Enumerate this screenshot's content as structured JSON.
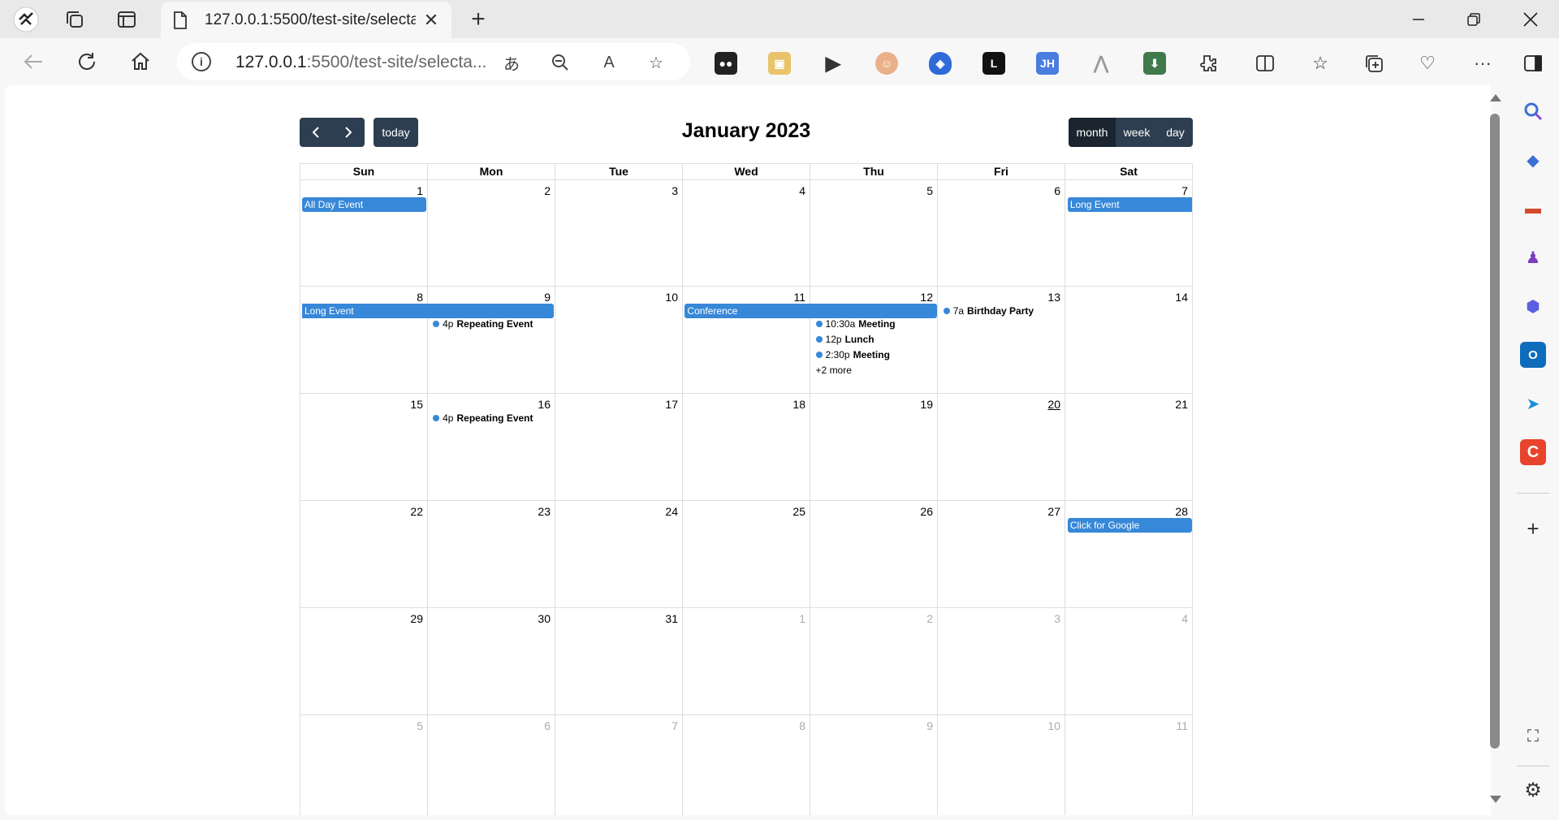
{
  "browser": {
    "tab_title": "127.0.0.1:5500/test-site/selectabl",
    "url_host": "127.0.0.1",
    "url_rest": ":5500/test-site/selecta...",
    "window_controls": [
      "minimize-icon",
      "restore-icon",
      "close-icon"
    ]
  },
  "calendar": {
    "title": "January 2023",
    "today_label": "today",
    "views": [
      "month",
      "week",
      "day"
    ],
    "active_view": "month",
    "day_headers": [
      "Sun",
      "Mon",
      "Tue",
      "Wed",
      "Thu",
      "Fri",
      "Sat"
    ],
    "weeks": [
      [
        {
          "n": "1"
        },
        {
          "n": "2"
        },
        {
          "n": "3"
        },
        {
          "n": "4"
        },
        {
          "n": "5"
        },
        {
          "n": "6"
        },
        {
          "n": "7"
        }
      ],
      [
        {
          "n": "8"
        },
        {
          "n": "9"
        },
        {
          "n": "10"
        },
        {
          "n": "11"
        },
        {
          "n": "12"
        },
        {
          "n": "13"
        },
        {
          "n": "14"
        }
      ],
      [
        {
          "n": "15"
        },
        {
          "n": "16"
        },
        {
          "n": "17"
        },
        {
          "n": "18"
        },
        {
          "n": "19"
        },
        {
          "n": "20",
          "today": true
        },
        {
          "n": "21"
        }
      ],
      [
        {
          "n": "22"
        },
        {
          "n": "23"
        },
        {
          "n": "24"
        },
        {
          "n": "25"
        },
        {
          "n": "26"
        },
        {
          "n": "27"
        },
        {
          "n": "28"
        }
      ],
      [
        {
          "n": "29"
        },
        {
          "n": "30"
        },
        {
          "n": "31"
        },
        {
          "n": "1",
          "other": true
        },
        {
          "n": "2",
          "other": true
        },
        {
          "n": "3",
          "other": true
        },
        {
          "n": "4",
          "other": true
        }
      ],
      [
        {
          "n": "5",
          "other": true
        },
        {
          "n": "6",
          "other": true
        },
        {
          "n": "7",
          "other": true
        },
        {
          "n": "8",
          "other": true
        },
        {
          "n": "9",
          "other": true
        },
        {
          "n": "10",
          "other": true
        },
        {
          "n": "11",
          "other": true
        }
      ]
    ],
    "events": {
      "all_day": "All Day Event",
      "long_event": "Long Event",
      "repeating_time": "4p",
      "repeating_name": "Repeating Event",
      "conference": "Conference",
      "meeting1_time": "10:30a",
      "meeting1_name": "Meeting",
      "lunch_time": "12p",
      "lunch_name": "Lunch",
      "meeting2_time": "2:30p",
      "meeting2_name": "Meeting",
      "more": "+2 more",
      "birthday_time": "7a",
      "birthday_name": "Birthday Party",
      "google": "Click for Google"
    }
  },
  "colors": {
    "event_blue": "#3788d8",
    "button_dark": "#2c3e50"
  }
}
